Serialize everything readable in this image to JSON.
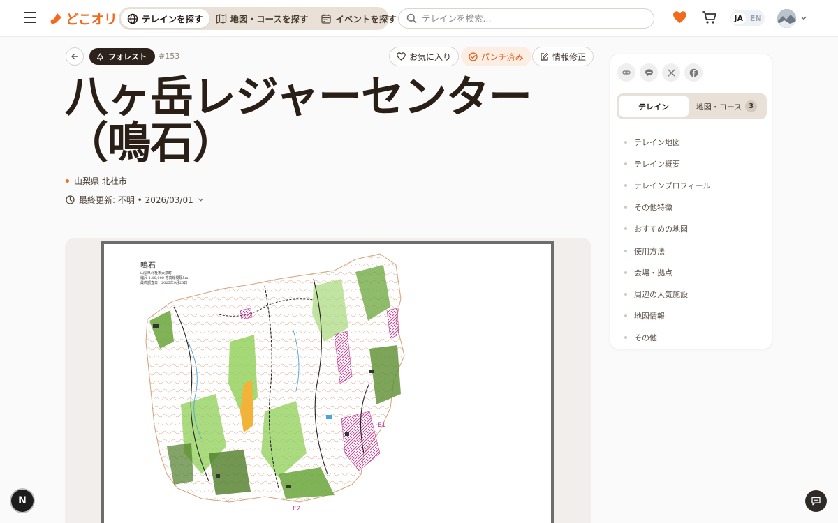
{
  "header": {
    "logo_text": "どこオリ",
    "nav": [
      {
        "label": "テレインを探す",
        "icon": "globe-icon",
        "active": true
      },
      {
        "label": "地図・コースを探す",
        "icon": "map-icon",
        "active": false
      },
      {
        "label": "イベントを探す",
        "icon": "calendar-icon",
        "active": false
      }
    ],
    "search_placeholder": "テレインを検索...",
    "lang_ja": "JA",
    "lang_en": "EN"
  },
  "article": {
    "category": "フォレスト",
    "id_text": "#153",
    "favorite_label": "お気に入り",
    "punched_label": "パンチ済み",
    "edit_label": "情報修正",
    "title": "八ヶ岳レジャーセンター（鳴石）",
    "location": "山梨県 北杜市",
    "updated": "最終更新: 不明 • 2026/03/01"
  },
  "map": {
    "map_title": "鳴石",
    "map_lines": [
      "山梨県北杜市大泉町",
      "縮尺 1:10,000 等高線間隔5m",
      "最終調査日：2025年9月25日"
    ],
    "marker_1": "E1",
    "marker_2": "E2"
  },
  "sidebar": {
    "share_icons": [
      "link-icon",
      "line-icon",
      "x-icon",
      "facebook-icon"
    ],
    "tab_terrain": "テレイン",
    "tab_maps": "地図・コース",
    "tab_maps_count": "3",
    "toc": [
      "テレイン地図",
      "テレイン概要",
      "テレインプロフィール",
      "その他特徴",
      "おすすめの地図",
      "使用方法",
      "会場・拠点",
      "周辺の人気施設",
      "地図情報",
      "その他"
    ]
  },
  "floating": {
    "n_label": "N"
  },
  "colors": {
    "brand": "#f26b1d",
    "ink": "#2a1f16",
    "tab_bg": "#e9e1d8"
  }
}
